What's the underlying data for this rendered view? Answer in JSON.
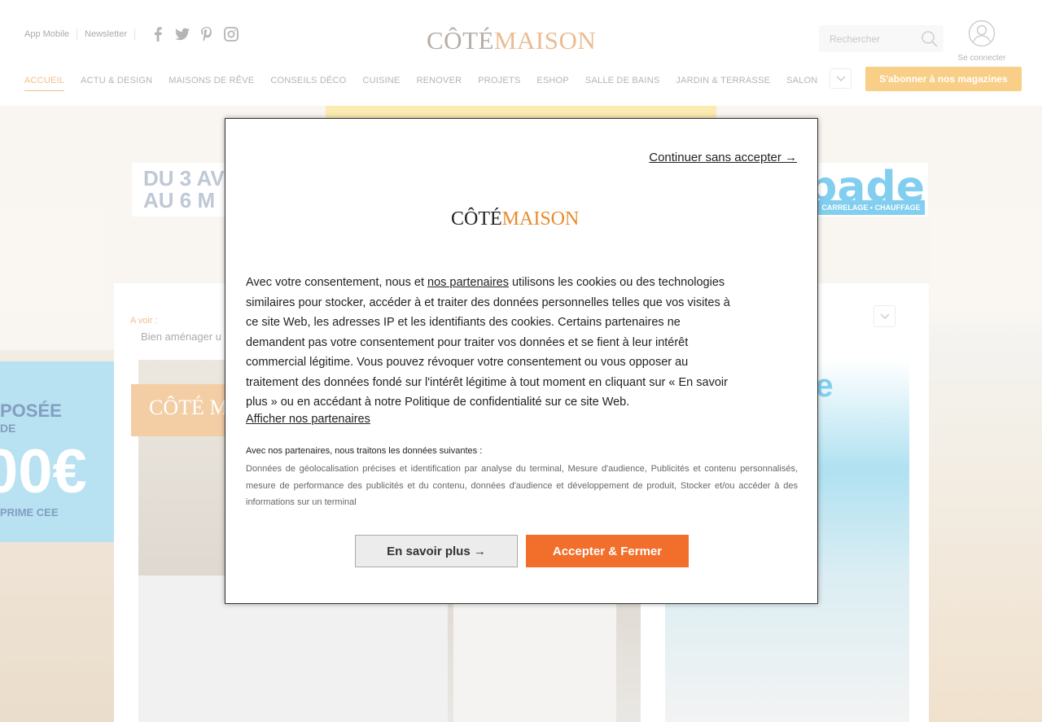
{
  "header": {
    "top_links": [
      "App Mobile",
      "Newsletter"
    ],
    "social": [
      "facebook-icon",
      "twitter-icon",
      "pinterest-icon",
      "instagram-icon"
    ],
    "logo": {
      "part1": "CÔTÉ",
      "part2": "MAISON"
    },
    "search": {
      "placeholder": "Rechercher"
    },
    "account_label": "Se connecter",
    "nav": [
      "ACCUEIL",
      "ACTU & DESIGN",
      "MAISONS DE RÊVE",
      "CONSEILS DÉCO",
      "CUISINE",
      "RENOVER",
      "PROJETS",
      "ESHOP",
      "SALLE DE BAINS",
      "JARDIN & TERRASSE",
      "SALON"
    ],
    "nav_active": "ACCUEIL",
    "subscribe_label": "S'abonner à nos magazines"
  },
  "background": {
    "ad": {
      "date_line1": "DU 3 AV",
      "date_line2": "AU 6 M",
      "brand": "ibade",
      "sub": "CARRELAGE • CHAUFFAGE"
    },
    "avoir_label": "A voir :",
    "avoir_link": "Bien aménager u",
    "hero_tag": "CÔTÉ M",
    "side_ad_text": "de",
    "left_ad_line1": "POSÉE",
    "left_ad_line2": "DE",
    "left_ad_big": "00€",
    "left_ad_line3": "PRIME CEE"
  },
  "modal": {
    "continue_label": "Continuer sans accepter →",
    "logo": {
      "part1": "CÔTÉ",
      "part2": "MAISON"
    },
    "text_before_link": "Avec votre consentement, nous et ",
    "partners_link": "nos partenaires",
    "text_after_link": " utilisons les cookies ou des technologies similaires pour stocker, accéder à et traiter des données personnelles telles que vos visites à ce site Web, les adresses IP et les identifiants des cookies. Certains partenaires ne demandent pas votre consentement pour traiter vos données et se fient à leur intérêt commercial légitime. Vous pouvez révoquer votre consentement ou vous opposer au traitement des données fondé sur l'intérêt légitime à tout moment en cliquant sur « En savoir plus » ou en accédant à notre Politique de confidentialité sur ce site Web.",
    "show_partners_label": "Afficher nos partenaires",
    "data_heading": "Avec nos partenaires, nous traitons les données suivantes :",
    "data_list": "Données de géolocalisation précises et identification par analyse du terminal, Mesure d'audience, Publicités et contenu personnalisés, mesure de performance des publicités et du contenu, données d'audience et développement de produit, Stocker et/ou accéder à des informations sur un terminal",
    "more_label": "En savoir plus →",
    "accept_label": "Accepter & Fermer"
  },
  "colors": {
    "accent": "#e98b2c",
    "accept_button": "#f26e2b",
    "subscribe": "#f5a623"
  }
}
